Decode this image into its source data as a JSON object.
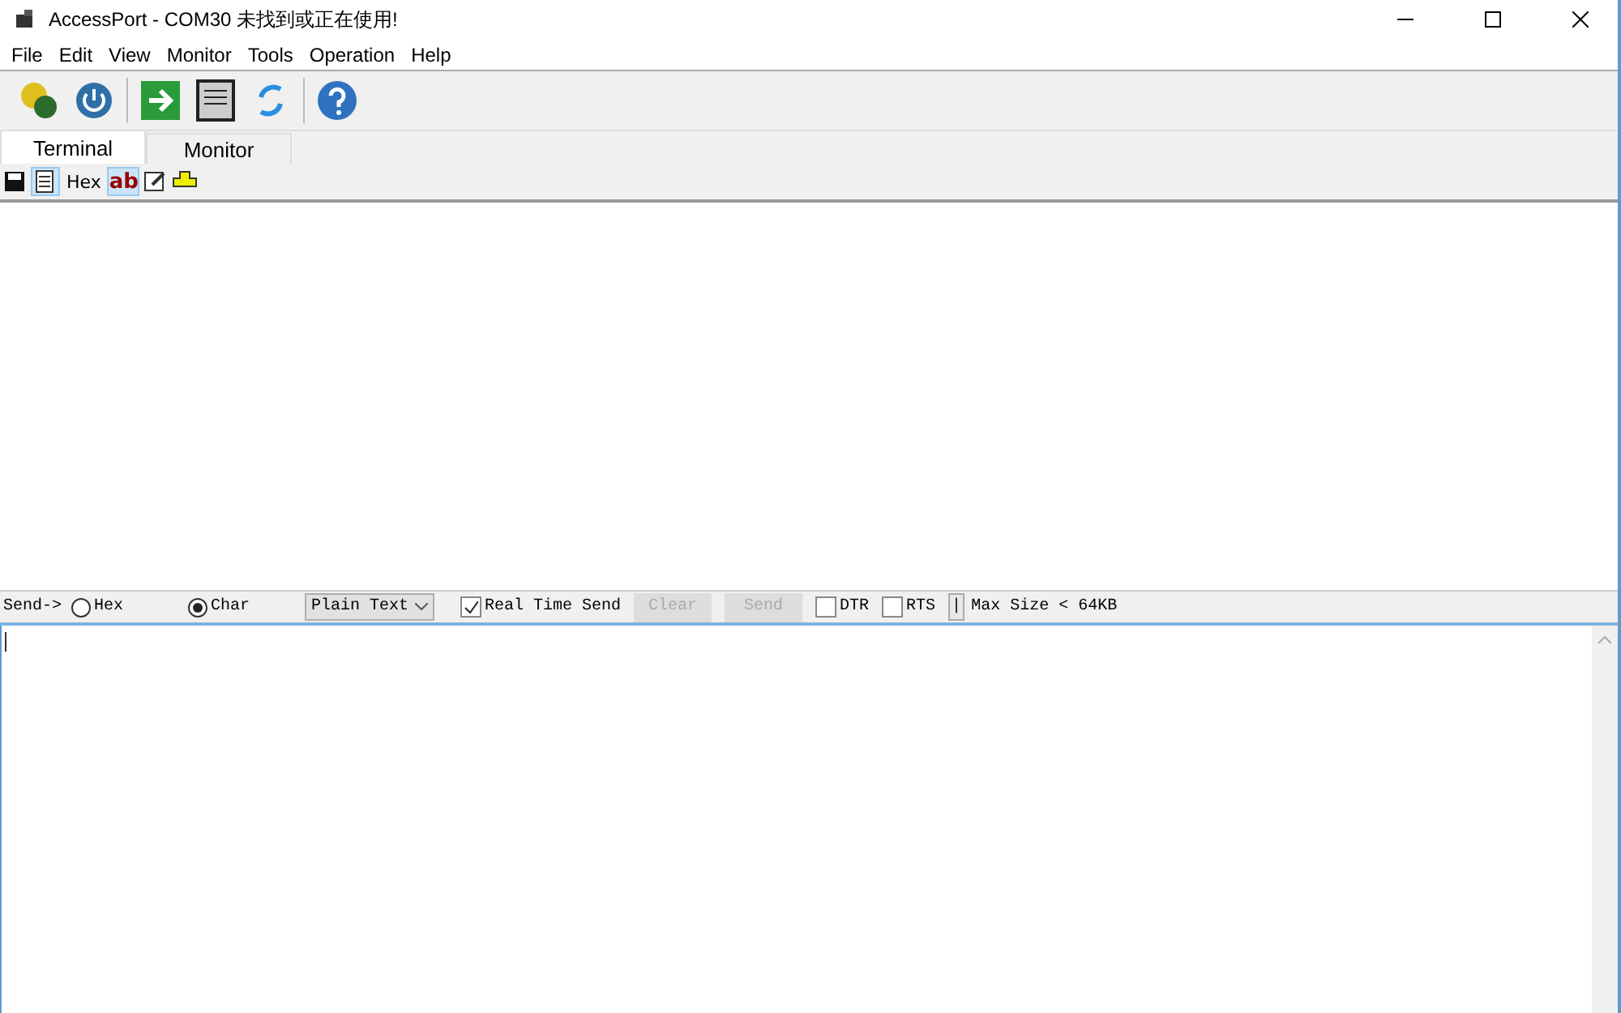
{
  "window": {
    "title": "AccessPort - COM30 未找到或正在使用!"
  },
  "menu": [
    "File",
    "Edit",
    "View",
    "Monitor",
    "Tools",
    "Operation",
    "Help"
  ],
  "tabs": [
    {
      "label": "Terminal",
      "selected": true
    },
    {
      "label": "Monitor",
      "selected": false
    }
  ],
  "view_toolbar": {
    "hex_label": "Hex",
    "ab_label": "ab",
    "hex_view_selected": true,
    "char_view_selected": true
  },
  "send_bar": {
    "label": "Send->",
    "modes": [
      {
        "label": "Hex",
        "selected": false
      },
      {
        "label": "Char",
        "selected": true
      }
    ],
    "format": "Plain Text",
    "real_time_send": {
      "label": "Real Time Send",
      "checked": true
    },
    "buttons": [
      {
        "label": "Clear",
        "disabled": true
      },
      {
        "label": "Send",
        "disabled": true
      }
    ],
    "lines": [
      {
        "label": "DTR",
        "checked": false
      },
      {
        "label": "RTS",
        "checked": false
      }
    ],
    "divider_button": "|",
    "max_size": "Max Size < 64KB"
  }
}
